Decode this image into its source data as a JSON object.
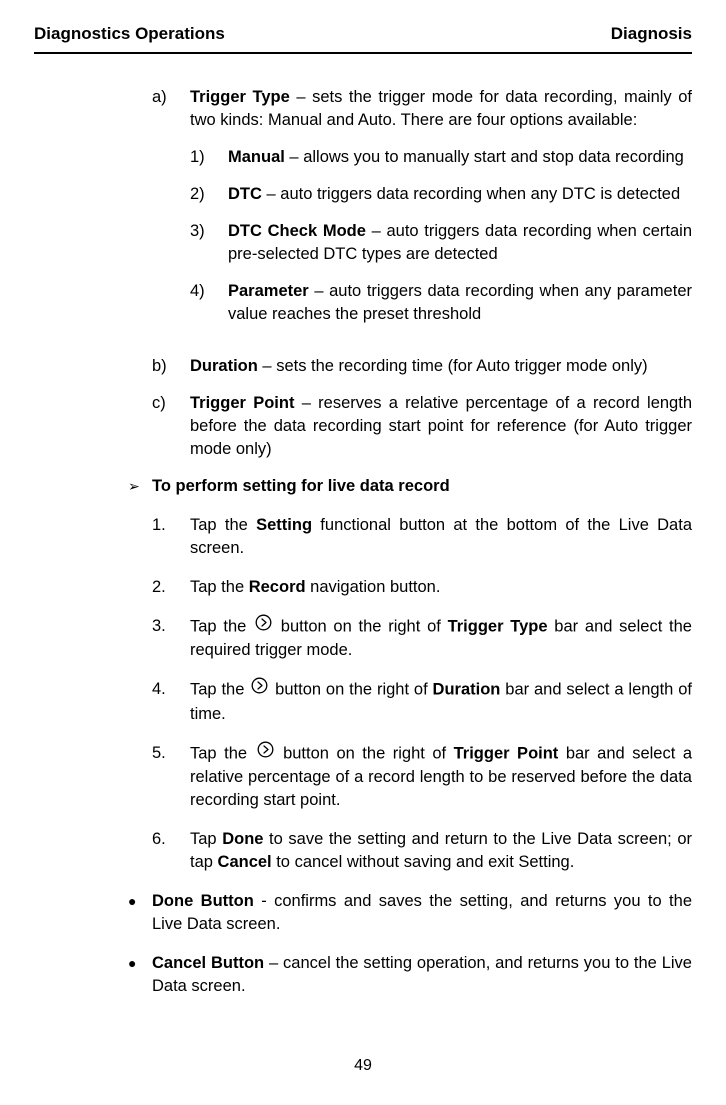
{
  "header": {
    "left": "Diagnostics Operations",
    "right": "Diagnosis"
  },
  "a": {
    "marker": "a)",
    "lead": "Trigger Type",
    "rest": " – sets the trigger mode for data recording, mainly of two kinds: Manual and Auto. There are four options available:",
    "n1m": "1)",
    "n1b": "Manual",
    "n1r": " – allows you to manually start and stop data recording",
    "n2m": "2)",
    "n2b": "DTC",
    "n2r": " – auto triggers data recording when any DTC is detected",
    "n3m": "3)",
    "n3b": "DTC Check Mode",
    "n3r": " – auto triggers data recording when certain pre-selected DTC types are detected",
    "n4m": "4)",
    "n4b": "Parameter",
    "n4r": " – auto triggers data recording when any parameter value reaches the preset threshold"
  },
  "b": {
    "marker": "b)",
    "lead": "Duration",
    "rest": " – sets the recording time (for Auto trigger mode only)"
  },
  "c": {
    "marker": "c)",
    "lead": "Trigger Point",
    "rest": " – reserves a relative percentage of a record length before the data recording start point for reference (for Auto trigger mode only)"
  },
  "proc": {
    "title": "To perform setting for live data record"
  },
  "s1": {
    "m": "1.",
    "t1": "Tap the ",
    "b": "Setting",
    "t2": " functional button at the bottom of the Live Data screen."
  },
  "s2": {
    "m": "2.",
    "t1": "Tap the ",
    "b": "Record",
    "t2": " navigation button."
  },
  "s3": {
    "m": "3.",
    "t1": "Tap the ",
    "t2": " button on the right of ",
    "b": "Trigger Type",
    "t3": " bar and select the required trigger mode."
  },
  "s4": {
    "m": "4.",
    "t1": "Tap the ",
    "t2": " button on the right of ",
    "b": "Duration",
    "t3": " bar and select a length of time."
  },
  "s5": {
    "m": "5.",
    "t1": "Tap the ",
    "t2": " button on the right of ",
    "b": "Trigger Point",
    "t3": " bar and select a relative percentage of a record length to be reserved before the data recording start point."
  },
  "s6": {
    "m": "6.",
    "t1": "Tap ",
    "b1": "Done",
    "t2": " to save the setting and return to the Live Data screen; or tap ",
    "b2": "Cancel",
    "t3": " to cancel without saving and exit Setting."
  },
  "done": {
    "b": "Done Button",
    "t": " - confirms and saves the setting, and returns you to the Live Data screen."
  },
  "cancel": {
    "b": "Cancel Button",
    "t": " – cancel the setting operation, and returns you to the Live Data screen."
  },
  "page": "49"
}
